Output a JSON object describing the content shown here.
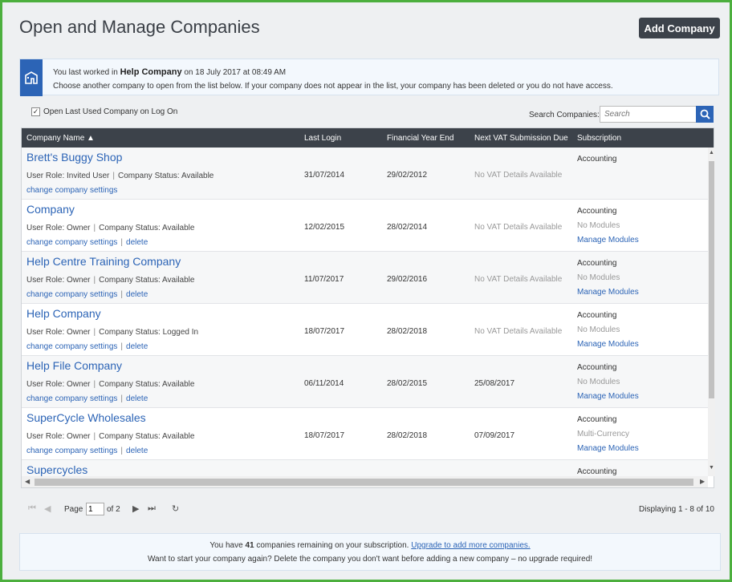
{
  "header": {
    "title": "Open and Manage Companies",
    "add_button": "Add Company"
  },
  "info": {
    "prefix": "You last worked in",
    "company": "Help Company",
    "suffix": "on 18 July 2017 at 08:49 AM",
    "line2": "Choose another company to open from the list below. If your company does not appear in the list, your company has been deleted or you do not have access."
  },
  "options": {
    "open_last_label": "Open Last Used Company on Log On",
    "open_last_checked": true,
    "search_label": "Search Companies:",
    "search_placeholder": "Search"
  },
  "columns": {
    "name": "Company Name ▲",
    "last_login": "Last Login",
    "fye": "Financial Year End",
    "vat": "Next VAT Submission Due",
    "subscription": "Subscription"
  },
  "labels": {
    "user_role": "User Role:",
    "company_status": "Company Status:",
    "change_settings": "change company settings",
    "delete": "delete",
    "sep": "|"
  },
  "companies": [
    {
      "name": "Brett's Buggy Shop",
      "role": "Invited User",
      "status": "Available",
      "last_login": "31/07/2014",
      "fye": "29/02/2012",
      "vat": "No VAT Details Available",
      "sub1": "Accounting",
      "sub2": "",
      "sub3": ""
    },
    {
      "name": "Company",
      "role": "Owner",
      "status": "Available",
      "last_login": "12/02/2015",
      "fye": "28/02/2014",
      "vat": "No VAT Details Available",
      "sub1": "Accounting",
      "sub2": "No Modules",
      "sub3": "Manage Modules"
    },
    {
      "name": "Help Centre Training Company",
      "role": "Owner",
      "status": "Available",
      "last_login": "11/07/2017",
      "fye": "29/02/2016",
      "vat": "No VAT Details Available",
      "sub1": "Accounting",
      "sub2": "No Modules",
      "sub3": "Manage Modules"
    },
    {
      "name": "Help Company",
      "role": "Owner",
      "status": "Logged In",
      "last_login": "18/07/2017",
      "fye": "28/02/2018",
      "vat": "No VAT Details Available",
      "sub1": "Accounting",
      "sub2": "No Modules",
      "sub3": "Manage Modules"
    },
    {
      "name": "Help File Company",
      "role": "Owner",
      "status": "Available",
      "last_login": "06/11/2014",
      "fye": "28/02/2015",
      "vat": "25/08/2017",
      "sub1": "Accounting",
      "sub2": "No Modules",
      "sub3": "Manage Modules"
    },
    {
      "name": "SuperCycle Wholesales",
      "role": "Owner",
      "status": "Available",
      "last_login": "18/07/2017",
      "fye": "28/02/2018",
      "vat": "07/09/2017",
      "sub1": "Accounting",
      "sub2": "Multi-Currency",
      "sub3": "Manage Modules"
    },
    {
      "name": "Supercycles",
      "role": "",
      "status": "",
      "last_login": "",
      "fye": "",
      "vat": "",
      "sub1": "Accounting",
      "sub2": "",
      "sub3": ""
    }
  ],
  "pager": {
    "page_label": "Page",
    "page_value": "1",
    "of_label": "of 2",
    "displaying": "Displaying 1 - 8 of 10"
  },
  "footer": {
    "line1_prefix": "You have",
    "count": "41",
    "line1_mid": "companies remaining on your subscription.",
    "upgrade_link": "Upgrade to add more companies.",
    "line2": "Want to start your company again? Delete the company you don't want before adding a new company – no upgrade required!"
  },
  "colors": {
    "accent": "#2c64b6",
    "header_bg": "#3c424a",
    "frame": "#4caf3e"
  }
}
